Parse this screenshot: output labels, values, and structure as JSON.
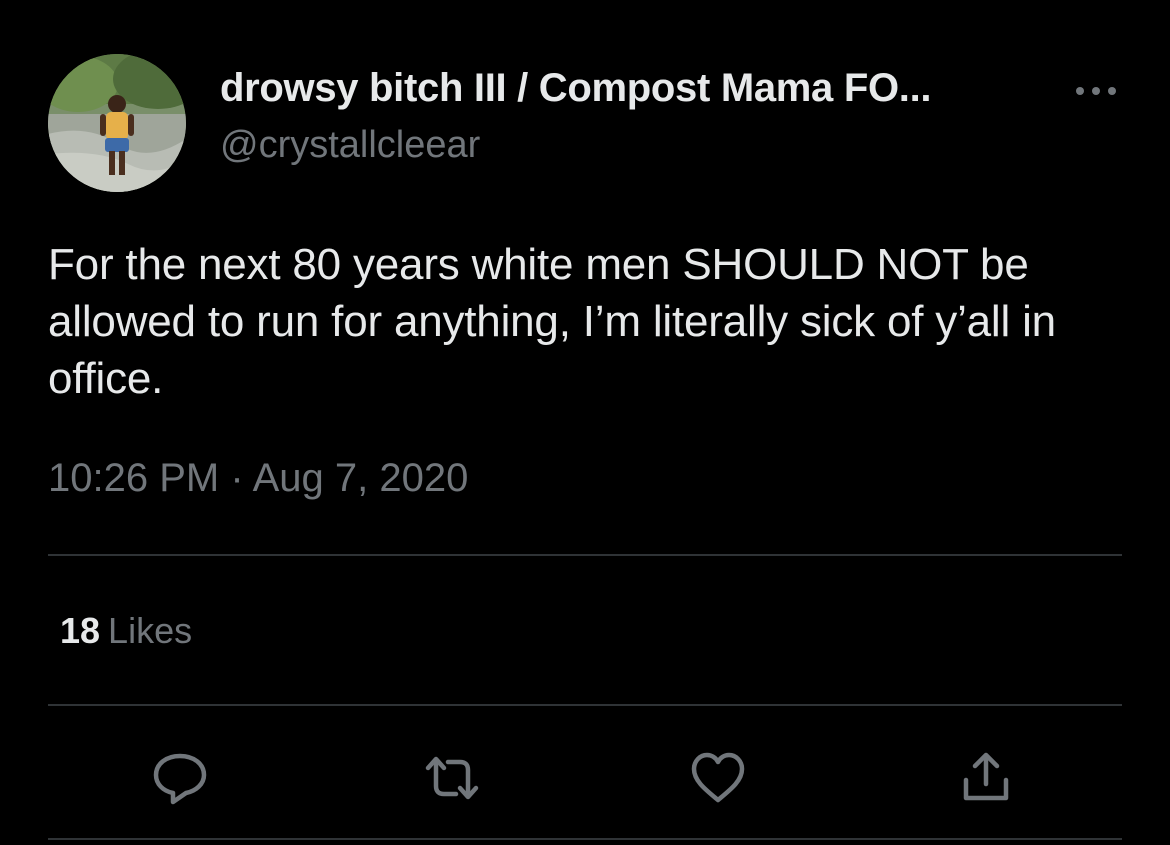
{
  "tweet": {
    "display_name": "drowsy bitch III / Compost Mama FO...",
    "handle": "@crystallcleear",
    "text": "For the next 80 years white men SHOULD NOT be allowed to run for anything, I’m literally sick of y’all in office.",
    "time": "10:26 PM",
    "separator": "·",
    "date": "Aug 7, 2020",
    "likes_count": "18",
    "likes_label": "Likes"
  },
  "icons": {
    "more": "more-horizontal-icon",
    "reply": "reply-icon",
    "retweet": "retweet-icon",
    "like": "heart-icon",
    "share": "share-icon"
  },
  "colors": {
    "background": "#000000",
    "primary_text": "#e7e9ea",
    "secondary_text": "#71767b",
    "divider": "#2f3336"
  }
}
